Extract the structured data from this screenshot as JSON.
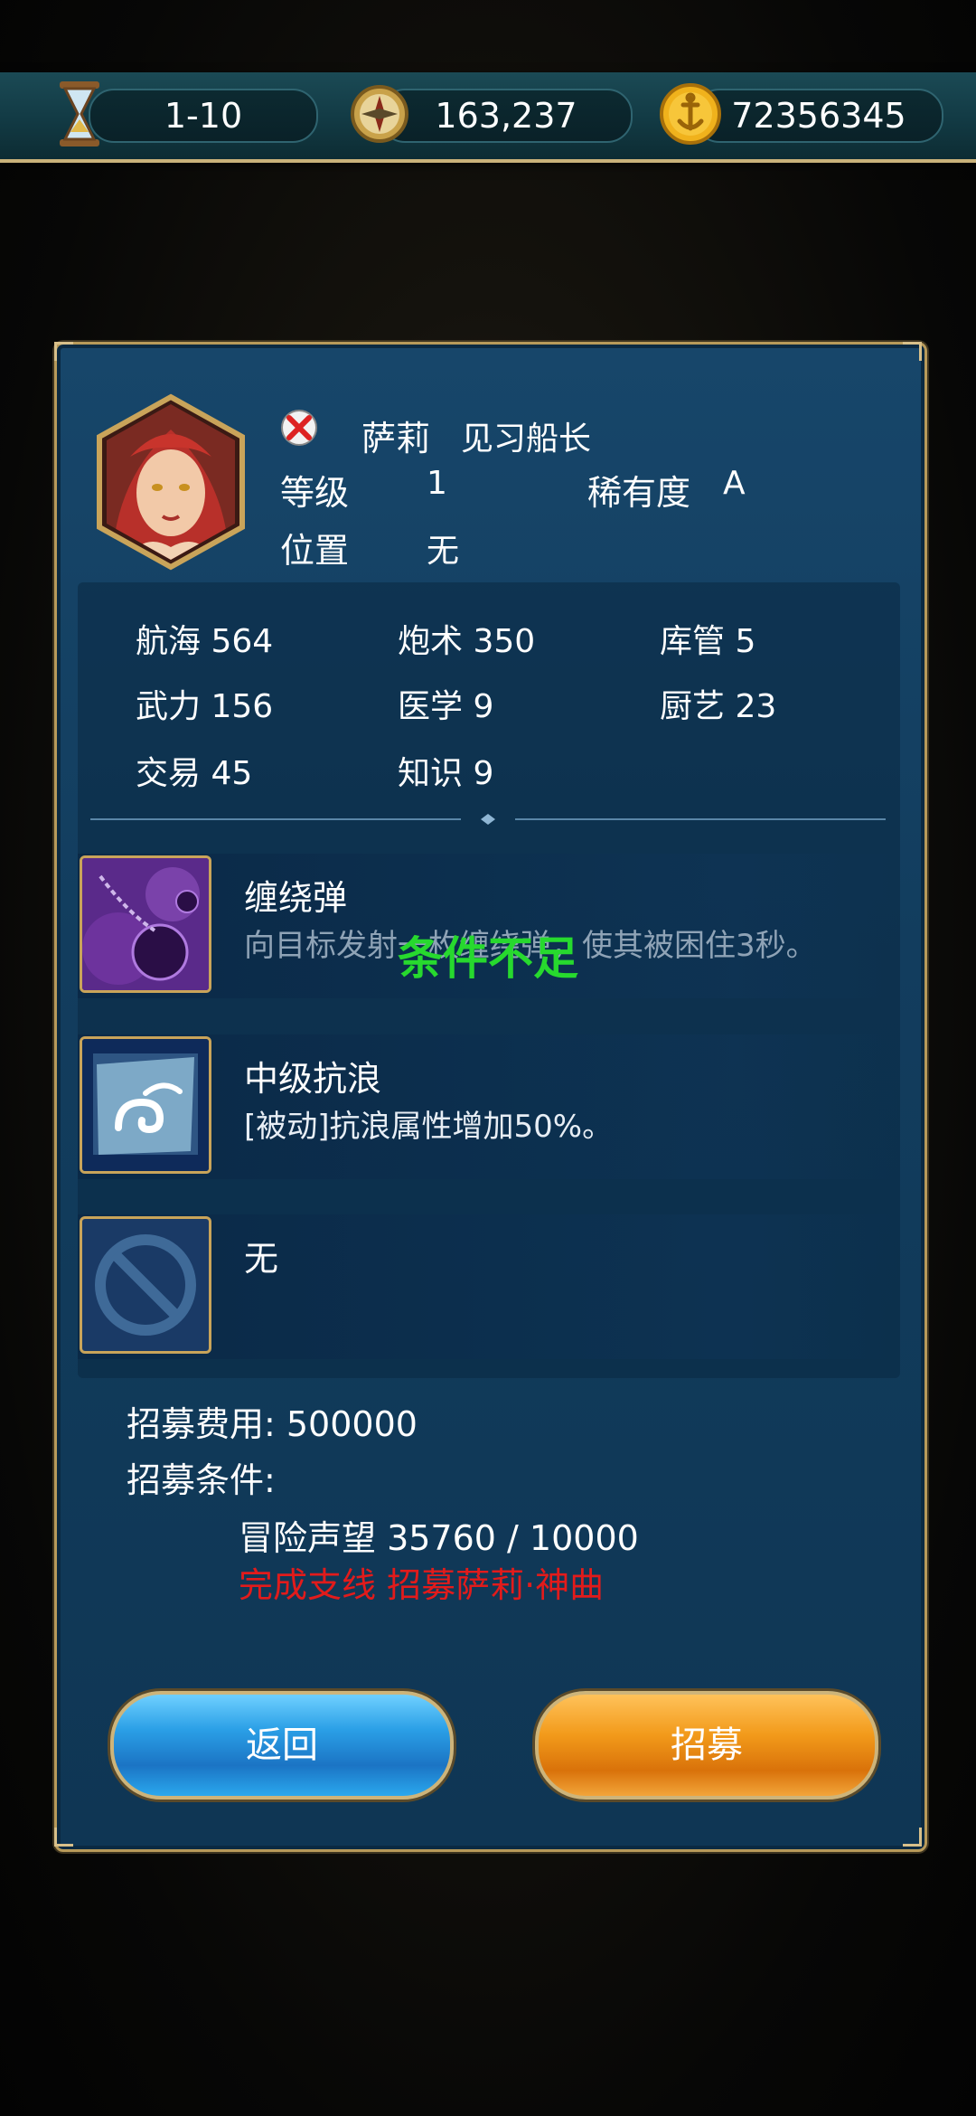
{
  "topbar": {
    "stage": "1-10",
    "compass_value": "163,237",
    "gold_value": "72356345",
    "icons": [
      "hourglass-icon",
      "compass-icon",
      "anchor-coin-icon"
    ]
  },
  "officer": {
    "name": "萨莉",
    "title": "见习船长",
    "level_label": "等级",
    "level_value": "1",
    "rarity_label": "稀有度",
    "rarity_value": "A",
    "position_label": "位置",
    "position_value": "无"
  },
  "stats": [
    {
      "label": "航海",
      "value": "564"
    },
    {
      "label": "炮术",
      "value": "350"
    },
    {
      "label": "库管",
      "value": "5"
    },
    {
      "label": "武力",
      "value": "156"
    },
    {
      "label": "医学",
      "value": "9"
    },
    {
      "label": "厨艺",
      "value": "23"
    },
    {
      "label": "交易",
      "value": "45"
    },
    {
      "label": "知识",
      "value": "9"
    }
  ],
  "skills": [
    {
      "name": "缠绕弹",
      "desc": "向目标发射一枚缠绕弹，使其被困住3秒。",
      "locked": true
    },
    {
      "name": "中级抗浪",
      "desc": "[被动]抗浪属性增加50%。",
      "locked": false
    },
    {
      "name": "无",
      "desc": "",
      "locked": false
    }
  ],
  "condition_overlay": "条件不足",
  "recruit": {
    "cost_label": "招募费用: 500000",
    "conditions_label": "招募条件:",
    "condition_reputation": "冒险声望 35760 / 10000",
    "condition_quest": "完成支线 招募萨莉·神曲"
  },
  "buttons": {
    "back": "返回",
    "recruit": "招募"
  },
  "colors": {
    "accent_gold": "#c9a45a",
    "condition_unmet": "#e21b1b",
    "overlay_green": "#27d92e"
  }
}
